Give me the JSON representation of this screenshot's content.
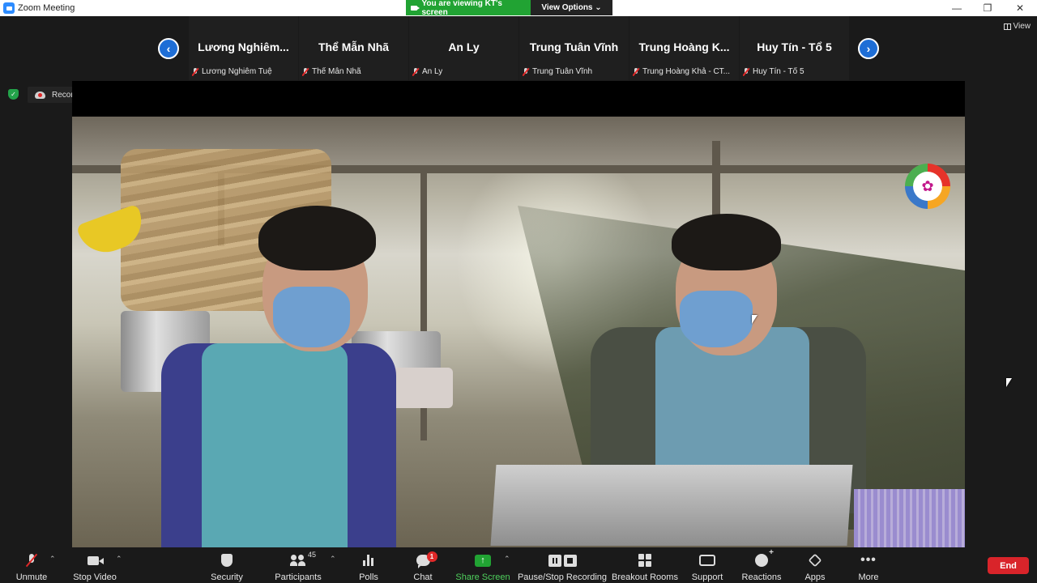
{
  "window": {
    "title": "Zoom Meeting"
  },
  "share_banner": {
    "viewing_text": "You are viewing KT's screen",
    "view_options_label": "View Options ⌄"
  },
  "view_button": {
    "label": "View"
  },
  "participants_strip": [
    {
      "name": "Lương  Nghiêm...",
      "label": "Lương Nghiêm Tuệ"
    },
    {
      "name": "Thể Mẫn Nhã",
      "label": "Thể Mẫn Nhã"
    },
    {
      "name": "An Ly",
      "label": "An Ly"
    },
    {
      "name": "Trung Tuân Vĩnh",
      "label": "Trung Tuân Vĩnh"
    },
    {
      "name": "Trung Hoàng K...",
      "label": "Trung Hoàng Khả - CT..."
    },
    {
      "name": "Huy Tín - Tổ 5",
      "label": "Huy Tín - Tổ 5"
    }
  ],
  "recording": {
    "label": "Recording..."
  },
  "toolbar": {
    "unmute": "Unmute",
    "stop_video": "Stop Video",
    "security": "Security",
    "participants": "Participants",
    "participants_count": "45",
    "polls": "Polls",
    "chat": "Chat",
    "chat_badge": "1",
    "share_screen": "Share Screen",
    "pause_stop_recording": "Pause/Stop Recording",
    "breakout_rooms": "Breakout Rooms",
    "support": "Support",
    "reactions": "Reactions",
    "apps": "Apps",
    "more": "More",
    "end": "End"
  },
  "colors": {
    "zoom_blue": "#2d8cff",
    "share_green": "#21a333",
    "end_red": "#d9242a",
    "nav_arrow_blue": "#1e6ed6",
    "muted_red": "#e02828"
  }
}
